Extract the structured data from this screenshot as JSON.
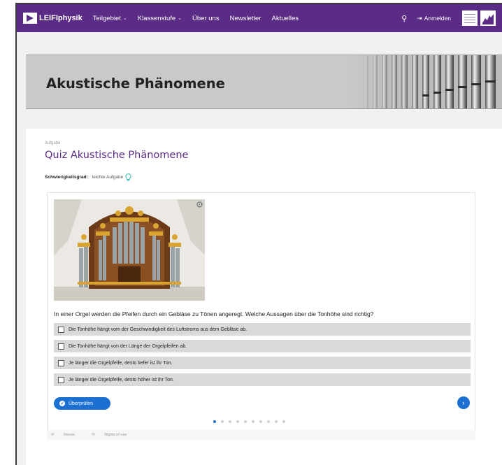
{
  "nav": {
    "logo": "LEIFIphysik",
    "items": [
      {
        "label": "Teilgebiet",
        "dropdown": true
      },
      {
        "label": "Klassenstufe",
        "dropdown": true
      },
      {
        "label": "Über uns",
        "dropdown": false
      },
      {
        "label": "Newsletter",
        "dropdown": false
      },
      {
        "label": "Aktuelles",
        "dropdown": false
      }
    ],
    "login_label": "Anmelden",
    "chev": "⌄",
    "search_glyph": "⚲",
    "login_glyph": "⇥"
  },
  "hero": {
    "title": "Akustische Phänomene"
  },
  "task": {
    "kicker": "Aufgabe",
    "title": "Quiz Akustische Phänomene",
    "difficulty_label": "Schwierigkeitsgrad:",
    "difficulty_value": "leichte Aufgabe"
  },
  "quiz": {
    "question": "In einer Orgel werden die Pfeifen durch ein Gebläse zu Tönen angeregt. Welche Aussagen über die Tonhöhe sind richtig?",
    "options": [
      "Die Tonhöhe hängt vom der Geschwindigkeit des Luftstroms aus dem Gebläse ab.",
      "Die Tonhöhe hängt von der Länge der Orgelpfeifen ab.",
      "Je länger die Orgelpfeife, desto tiefer ist ihr Ton.",
      "Je länger die Orgelpfeife, desto höher ist ihr Ton."
    ],
    "check_label": "Überprüfen",
    "check_glyph": "✔",
    "next_glyph": "›",
    "pages_total": 10,
    "page_current": 1
  },
  "footer": {
    "reuse": "Reuse",
    "rights": "Rights of use"
  },
  "colors": {
    "brand": "#5b2c86",
    "accent": "#1a6fd0",
    "option_bg": "#d9d9d9",
    "bulb": "#2bb8b0"
  },
  "icons": [
    "logo-icon",
    "search-icon",
    "login-icon",
    "partner-badge-icon",
    "partner-logo-icon",
    "organ-pipes-image",
    "bulb-icon",
    "zoom-icon",
    "check-circle-icon",
    "chevron-right-icon",
    "reuse-icon",
    "rights-icon"
  ]
}
